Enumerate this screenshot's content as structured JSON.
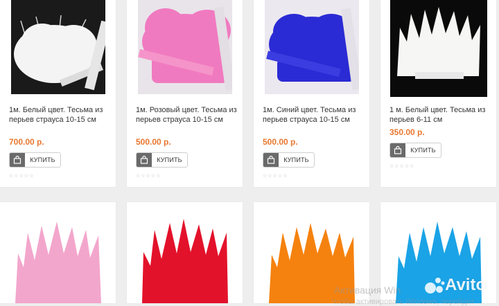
{
  "products_top": [
    {
      "title": "1м. Белый цвет. Тесьма из перьев страуса 10-15 см",
      "price": "700.00 р.",
      "buy_label": "КУПИТЬ",
      "feather_color": "#f4f4f4",
      "bg_color": "#1a1a1a"
    },
    {
      "title": "1м. Розовый цвет. Тесьма из перьев страуса 10-15 см",
      "price": "500.00 р.",
      "buy_label": "КУПИТЬ",
      "feather_color": "#f07ac0",
      "bg_color": "#e9e4ea"
    },
    {
      "title": "1м. Синий цвет. Тесьма из перьев страуса 10-15 см",
      "price": "500.00 р.",
      "buy_label": "КУПИТЬ",
      "feather_color": "#2a2bd4",
      "bg_color": "#ece8ef"
    },
    {
      "title": "1 м. Белый цвет. Тесьма из перьев 6-11 см",
      "price": "350.00 р.",
      "buy_label": "КУПИТЬ",
      "feather_color": "#f6f6f4",
      "bg_color": "#0a0a0a"
    }
  ],
  "products_bottom": [
    {
      "feather_color": "#f3a6cc"
    },
    {
      "feather_color": "#e3122b"
    },
    {
      "feather_color": "#f5820f"
    },
    {
      "feather_color": "#1aa3e6"
    }
  ],
  "rating_stars": "☆☆☆☆☆",
  "watermark": {
    "line1": "Активация Win",
    "line2": "Чтобы активировать Windows, перейдит",
    "avito": "Avito"
  }
}
